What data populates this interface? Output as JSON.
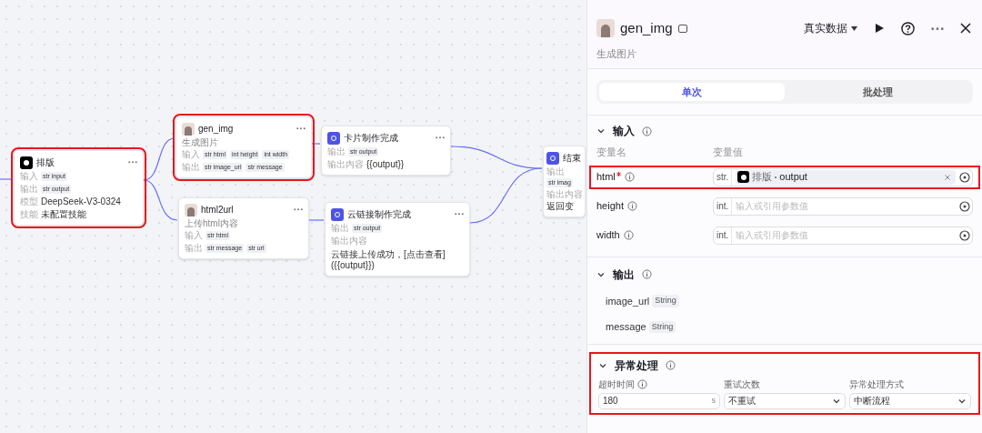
{
  "canvas": {
    "nodes": [
      {
        "kind": "llm",
        "title": "排版",
        "rows": [
          {
            "label": "输入",
            "tags": [
              {
                "type": "str",
                "name": "input"
              }
            ]
          },
          {
            "label": "输出",
            "tags": [
              {
                "type": "str",
                "name": "output"
              }
            ]
          },
          {
            "label": "模型",
            "text": "DeepSeek-V3-0324"
          },
          {
            "label": "技能",
            "text": "未配置技能"
          }
        ],
        "highlighted": true
      },
      {
        "kind": "plugin",
        "title": "gen_img",
        "description": "生成图片",
        "rows": [
          {
            "label": "输入",
            "tags": [
              {
                "type": "str",
                "name": "html"
              },
              {
                "type": "int",
                "name": "height"
              },
              {
                "type": "int",
                "name": "width"
              }
            ]
          },
          {
            "label": "输出",
            "tags": [
              {
                "type": "str",
                "name": "image_url"
              },
              {
                "type": "str",
                "name": "message"
              }
            ]
          }
        ],
        "highlighted": true
      },
      {
        "kind": "plugin",
        "title": "html2url",
        "description": "上传html内容",
        "rows": [
          {
            "label": "输入",
            "tags": [
              {
                "type": "str",
                "name": "html"
              }
            ]
          },
          {
            "label": "输出",
            "tags": [
              {
                "type": "str",
                "name": "message"
              },
              {
                "type": "str",
                "name": "url"
              }
            ]
          }
        ],
        "highlighted": false
      },
      {
        "kind": "message",
        "title": "卡片制作完成",
        "rows": [
          {
            "label": "输出",
            "tags": [
              {
                "type": "str",
                "name": "output"
              }
            ]
          },
          {
            "label": "输出内容",
            "text": "{{output}}"
          }
        ],
        "highlighted": false
      },
      {
        "kind": "message",
        "title": "云链接制作完成",
        "rows": [
          {
            "label": "输出",
            "tags": [
              {
                "type": "str",
                "name": "output"
              }
            ]
          },
          {
            "label": "输出内容",
            "text": "云链接上传成功，[点击查看]({{output}})"
          }
        ],
        "highlighted": false
      },
      {
        "kind": "end",
        "title": "结束",
        "rows": [
          {
            "label": "输出",
            "tags": [
              {
                "type": "str",
                "name": "imag"
              }
            ]
          },
          {
            "label": "输出内容",
            "text": "返回变"
          }
        ],
        "highlighted": false
      }
    ]
  },
  "panel": {
    "title": "gen_img",
    "description": "生成图片",
    "data_mode": "真实数据",
    "tabs": [
      {
        "label": "单次",
        "selected": true
      },
      {
        "label": "批处理",
        "selected": false
      }
    ],
    "input": {
      "title": "输入",
      "expanded": true,
      "columns": [
        "变量名",
        "变量值"
      ],
      "params": [
        {
          "name": "html",
          "required": true,
          "highlighted": true,
          "type": "str.",
          "ref_node": "排版",
          "ref_field": "output"
        },
        {
          "name": "height",
          "required": false,
          "highlighted": false,
          "type": "int.",
          "placeholder": "输入或引用参数值"
        },
        {
          "name": "width",
          "required": false,
          "highlighted": false,
          "type": "int.",
          "placeholder": "输入或引用参数值"
        }
      ]
    },
    "output": {
      "title": "输出",
      "expanded": true,
      "vars": [
        {
          "name": "image_url",
          "type": "String"
        },
        {
          "name": "message",
          "type": "String"
        }
      ]
    },
    "exception": {
      "title": "异常处理",
      "expanded": true,
      "highlighted": true,
      "fields": [
        {
          "kind": "number",
          "label": "超时时间",
          "info": true,
          "value": "180",
          "unit": "s"
        },
        {
          "kind": "select",
          "label": "重试次数",
          "info": false,
          "value": "不重试"
        },
        {
          "kind": "select",
          "label": "异常处理方式",
          "info": false,
          "value": "中断流程"
        }
      ]
    }
  }
}
